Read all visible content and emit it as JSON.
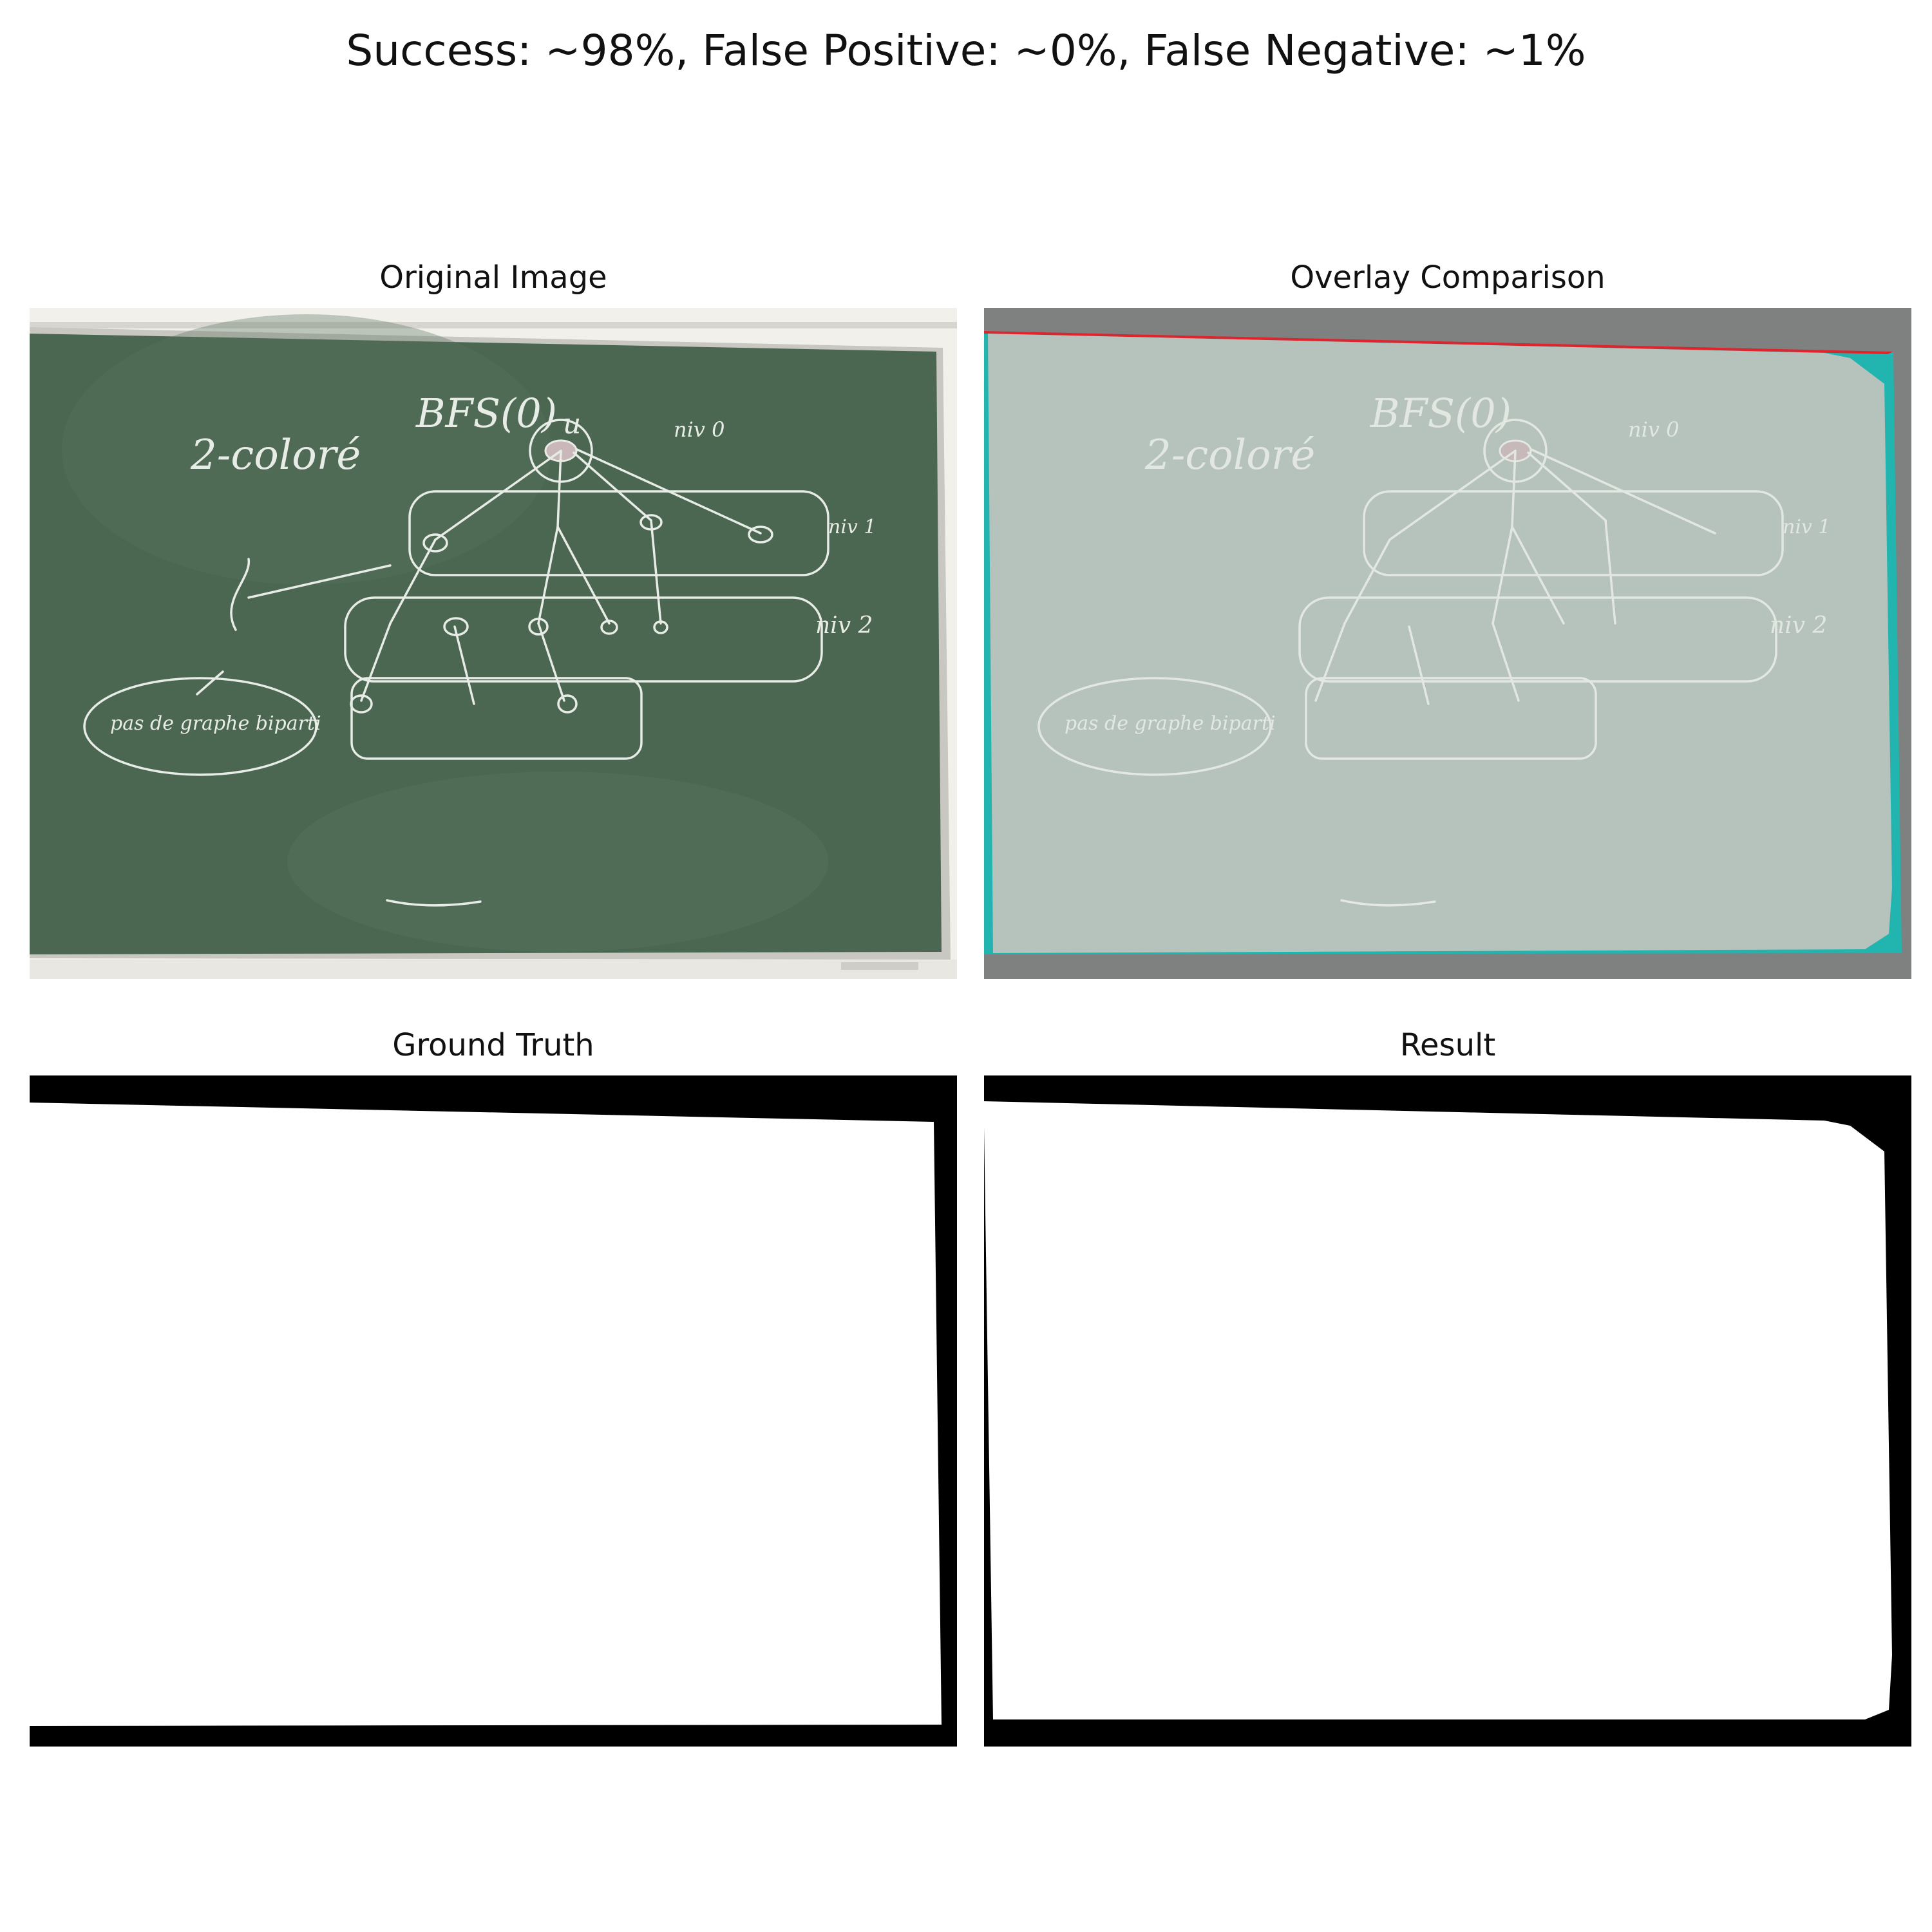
{
  "suptitle": "Success: ~98%, False Positive: ~0%, False Negative: ~1%",
  "panels": {
    "original": {
      "title": "Original Image"
    },
    "overlay": {
      "title": "Overlay Comparison"
    },
    "ground_truth": {
      "title": "Ground Truth"
    },
    "result": {
      "title": "Result"
    }
  },
  "board_text": {
    "heading_left": "2-coloré",
    "heading_bfs": "BFS(0)",
    "root": "u",
    "level0": "niv 0",
    "level1": "niv 1",
    "level2": "niv 2",
    "note": "pas de graphe biparti"
  },
  "colors": {
    "board": "#4b6651",
    "wall": "#f2f0ea",
    "chalk": "#e8ece6",
    "overlay_fill": "#b6c2bc",
    "false_positive": "#e0242d",
    "false_negative": "#22b5b0",
    "mask_foreground": "#ffffff",
    "mask_background": "#000000"
  }
}
